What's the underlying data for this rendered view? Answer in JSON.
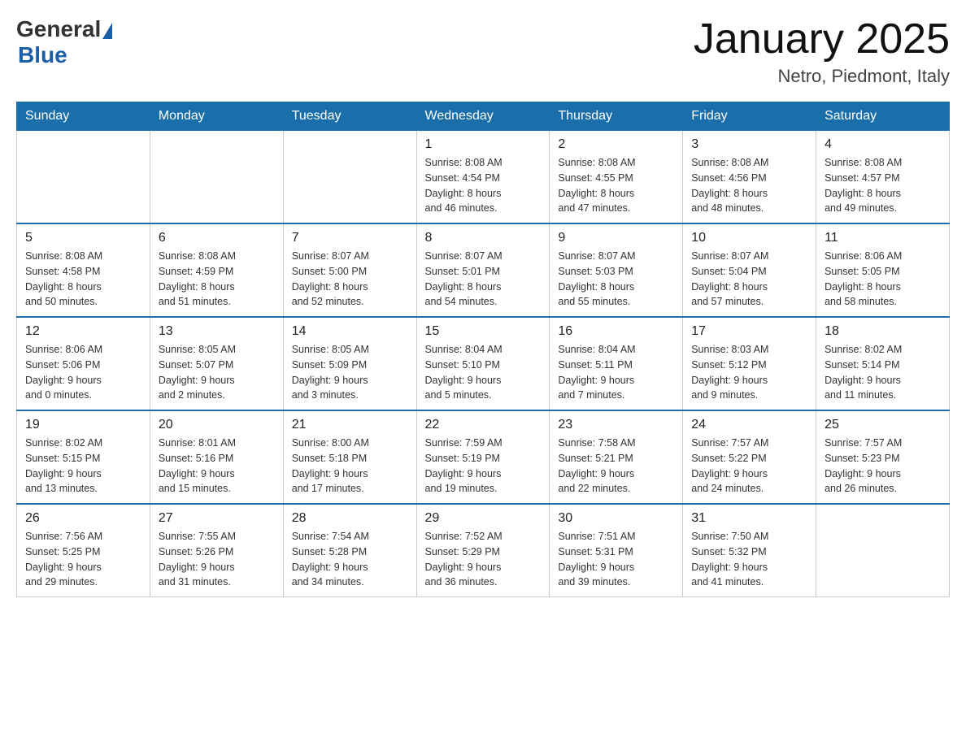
{
  "header": {
    "logo_general": "General",
    "logo_blue": "Blue",
    "title": "January 2025",
    "subtitle": "Netro, Piedmont, Italy"
  },
  "weekdays": [
    "Sunday",
    "Monday",
    "Tuesday",
    "Wednesday",
    "Thursday",
    "Friday",
    "Saturday"
  ],
  "weeks": [
    [
      {
        "day": "",
        "info": ""
      },
      {
        "day": "",
        "info": ""
      },
      {
        "day": "",
        "info": ""
      },
      {
        "day": "1",
        "info": "Sunrise: 8:08 AM\nSunset: 4:54 PM\nDaylight: 8 hours\nand 46 minutes."
      },
      {
        "day": "2",
        "info": "Sunrise: 8:08 AM\nSunset: 4:55 PM\nDaylight: 8 hours\nand 47 minutes."
      },
      {
        "day": "3",
        "info": "Sunrise: 8:08 AM\nSunset: 4:56 PM\nDaylight: 8 hours\nand 48 minutes."
      },
      {
        "day": "4",
        "info": "Sunrise: 8:08 AM\nSunset: 4:57 PM\nDaylight: 8 hours\nand 49 minutes."
      }
    ],
    [
      {
        "day": "5",
        "info": "Sunrise: 8:08 AM\nSunset: 4:58 PM\nDaylight: 8 hours\nand 50 minutes."
      },
      {
        "day": "6",
        "info": "Sunrise: 8:08 AM\nSunset: 4:59 PM\nDaylight: 8 hours\nand 51 minutes."
      },
      {
        "day": "7",
        "info": "Sunrise: 8:07 AM\nSunset: 5:00 PM\nDaylight: 8 hours\nand 52 minutes."
      },
      {
        "day": "8",
        "info": "Sunrise: 8:07 AM\nSunset: 5:01 PM\nDaylight: 8 hours\nand 54 minutes."
      },
      {
        "day": "9",
        "info": "Sunrise: 8:07 AM\nSunset: 5:03 PM\nDaylight: 8 hours\nand 55 minutes."
      },
      {
        "day": "10",
        "info": "Sunrise: 8:07 AM\nSunset: 5:04 PM\nDaylight: 8 hours\nand 57 minutes."
      },
      {
        "day": "11",
        "info": "Sunrise: 8:06 AM\nSunset: 5:05 PM\nDaylight: 8 hours\nand 58 minutes."
      }
    ],
    [
      {
        "day": "12",
        "info": "Sunrise: 8:06 AM\nSunset: 5:06 PM\nDaylight: 9 hours\nand 0 minutes."
      },
      {
        "day": "13",
        "info": "Sunrise: 8:05 AM\nSunset: 5:07 PM\nDaylight: 9 hours\nand 2 minutes."
      },
      {
        "day": "14",
        "info": "Sunrise: 8:05 AM\nSunset: 5:09 PM\nDaylight: 9 hours\nand 3 minutes."
      },
      {
        "day": "15",
        "info": "Sunrise: 8:04 AM\nSunset: 5:10 PM\nDaylight: 9 hours\nand 5 minutes."
      },
      {
        "day": "16",
        "info": "Sunrise: 8:04 AM\nSunset: 5:11 PM\nDaylight: 9 hours\nand 7 minutes."
      },
      {
        "day": "17",
        "info": "Sunrise: 8:03 AM\nSunset: 5:12 PM\nDaylight: 9 hours\nand 9 minutes."
      },
      {
        "day": "18",
        "info": "Sunrise: 8:02 AM\nSunset: 5:14 PM\nDaylight: 9 hours\nand 11 minutes."
      }
    ],
    [
      {
        "day": "19",
        "info": "Sunrise: 8:02 AM\nSunset: 5:15 PM\nDaylight: 9 hours\nand 13 minutes."
      },
      {
        "day": "20",
        "info": "Sunrise: 8:01 AM\nSunset: 5:16 PM\nDaylight: 9 hours\nand 15 minutes."
      },
      {
        "day": "21",
        "info": "Sunrise: 8:00 AM\nSunset: 5:18 PM\nDaylight: 9 hours\nand 17 minutes."
      },
      {
        "day": "22",
        "info": "Sunrise: 7:59 AM\nSunset: 5:19 PM\nDaylight: 9 hours\nand 19 minutes."
      },
      {
        "day": "23",
        "info": "Sunrise: 7:58 AM\nSunset: 5:21 PM\nDaylight: 9 hours\nand 22 minutes."
      },
      {
        "day": "24",
        "info": "Sunrise: 7:57 AM\nSunset: 5:22 PM\nDaylight: 9 hours\nand 24 minutes."
      },
      {
        "day": "25",
        "info": "Sunrise: 7:57 AM\nSunset: 5:23 PM\nDaylight: 9 hours\nand 26 minutes."
      }
    ],
    [
      {
        "day": "26",
        "info": "Sunrise: 7:56 AM\nSunset: 5:25 PM\nDaylight: 9 hours\nand 29 minutes."
      },
      {
        "day": "27",
        "info": "Sunrise: 7:55 AM\nSunset: 5:26 PM\nDaylight: 9 hours\nand 31 minutes."
      },
      {
        "day": "28",
        "info": "Sunrise: 7:54 AM\nSunset: 5:28 PM\nDaylight: 9 hours\nand 34 minutes."
      },
      {
        "day": "29",
        "info": "Sunrise: 7:52 AM\nSunset: 5:29 PM\nDaylight: 9 hours\nand 36 minutes."
      },
      {
        "day": "30",
        "info": "Sunrise: 7:51 AM\nSunset: 5:31 PM\nDaylight: 9 hours\nand 39 minutes."
      },
      {
        "day": "31",
        "info": "Sunrise: 7:50 AM\nSunset: 5:32 PM\nDaylight: 9 hours\nand 41 minutes."
      },
      {
        "day": "",
        "info": ""
      }
    ]
  ]
}
